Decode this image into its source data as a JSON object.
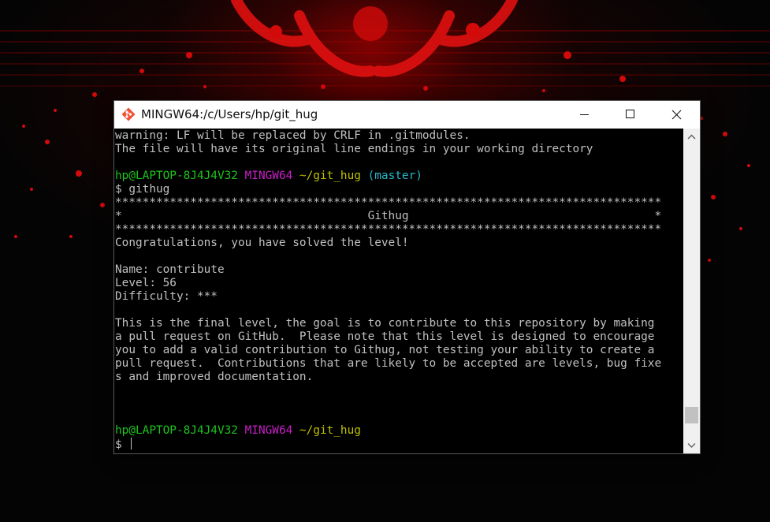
{
  "window": {
    "title": "MINGW64:/c/Users/hp/git_hug",
    "icon": "git-logo-icon",
    "controls": [
      "minimize-icon",
      "maximize-icon",
      "close-icon"
    ]
  },
  "terminal": {
    "colors": {
      "background": "#000000",
      "text": "#c0c0c0",
      "user_host": "#1cc41c",
      "shell": "#c71fc7",
      "path": "#c0c000",
      "branch": "#2bb7c7"
    },
    "warning_line_1": "warning: LF will be replaced by CRLF in .gitmodules.",
    "warning_line_2": "The file will have its original line endings in your working directory",
    "prompt_1": {
      "user_host": "hp@LAPTOP-8J4J4V32",
      "shell": "MINGW64",
      "path": "~/git_hug",
      "branch": "(master)"
    },
    "command_1": "$ githug",
    "stars_line_1": "********************************************************************************",
    "banner_line": "*                                    Githug                                    *",
    "stars_line_2": "********************************************************************************",
    "success_message": "Congratulations, you have solved the level!",
    "level_name": "Name: contribute",
    "level_number": "Level: 56",
    "level_difficulty": "Difficulty: ***",
    "description_lines": [
      "This is the final level, the goal is to contribute to this repository by making",
      "a pull request on GitHub.  Please note that this level is designed to encourage",
      "you to add a valid contribution to Githug, not testing your ability to create a",
      "pull request.  Contributions that are likely to be accepted are levels, bug fixe",
      "s and improved documentation."
    ],
    "prompt_2": {
      "user_host": "hp@LAPTOP-8J4J4V32",
      "shell": "MINGW64",
      "path": "~/git_hug"
    },
    "command_2": "$ "
  },
  "scrollbar": {
    "up_icon": "chevron-up-icon",
    "down_icon": "chevron-down-icon",
    "position": 0.95
  }
}
